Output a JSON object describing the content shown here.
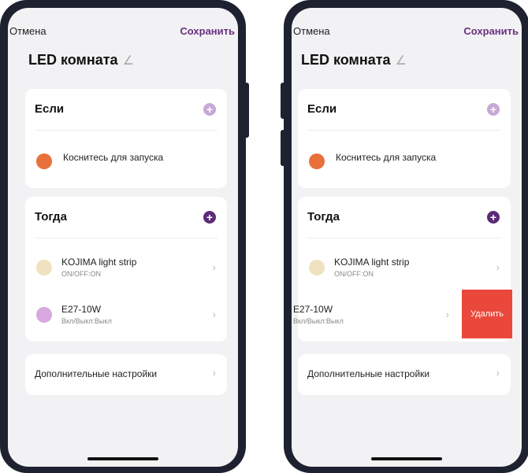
{
  "header": {
    "cancel": "Отмена",
    "save": "Сохранить"
  },
  "scene_title": "LED комната",
  "if_section": {
    "label": "Если",
    "trigger": "Коснитесь для запуска"
  },
  "then_section": {
    "label": "Тогда",
    "actions": [
      {
        "name": "KOJIMA light strip",
        "status": "ON/OFF:ON"
      },
      {
        "name": "E27-10W",
        "status": "Вкл/Выкл:Выкл"
      }
    ]
  },
  "additional_settings": "Дополнительные настройки",
  "swipe_action": {
    "delete_label": "Удалить"
  },
  "colors": {
    "accent": "#5b2a78",
    "delete": "#e9483b"
  }
}
